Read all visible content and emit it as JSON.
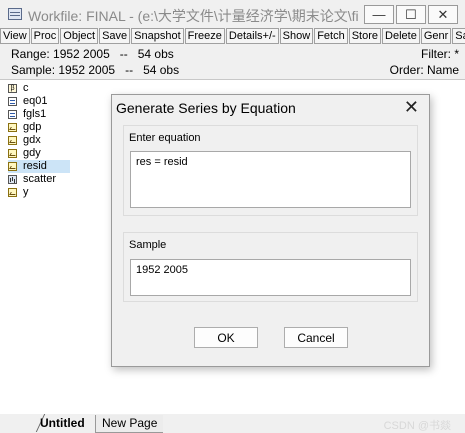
{
  "window": {
    "title": "Workfile: FINAL - (e:\\大学文件\\计量经济学\\期末论文\\final...",
    "controls": {
      "minimize": "—",
      "maximize": "☐",
      "close": "✕"
    }
  },
  "toolbar": {
    "buttons": [
      "View",
      "Proc",
      "Object",
      "Save",
      "Snapshot",
      "Freeze",
      "Details+/-",
      "Show",
      "Fetch",
      "Store",
      "Delete",
      "Genr",
      "Sam"
    ]
  },
  "info": {
    "range": "Range: 1952 2005   --   54 obs",
    "sample": "Sample: 1952 2005   --   54 obs",
    "filter": "Filter: *",
    "order": "Order: Name"
  },
  "objects": [
    {
      "name": "c",
      "icon": "scalar-icon"
    },
    {
      "name": "eq01",
      "icon": "equation-icon"
    },
    {
      "name": "fgls1",
      "icon": "equation-icon"
    },
    {
      "name": "gdp",
      "icon": "series-icon"
    },
    {
      "name": "gdx",
      "icon": "series-icon"
    },
    {
      "name": "gdy",
      "icon": "series-icon"
    },
    {
      "name": "resid",
      "icon": "series-icon"
    },
    {
      "name": "scatter",
      "icon": "graph-icon"
    },
    {
      "name": "y",
      "icon": "series-icon"
    }
  ],
  "dialog": {
    "title": "Generate Series by Equation",
    "close": "✕",
    "equation_label": "Enter equation",
    "equation_value": "res = resid",
    "sample_label": "Sample",
    "sample_value": "1952 2005",
    "ok_label": "OK",
    "cancel_label": "Cancel"
  },
  "tabs": {
    "active": "Untitled",
    "inactive": "New Page"
  },
  "watermark": "CSDN @书燚"
}
